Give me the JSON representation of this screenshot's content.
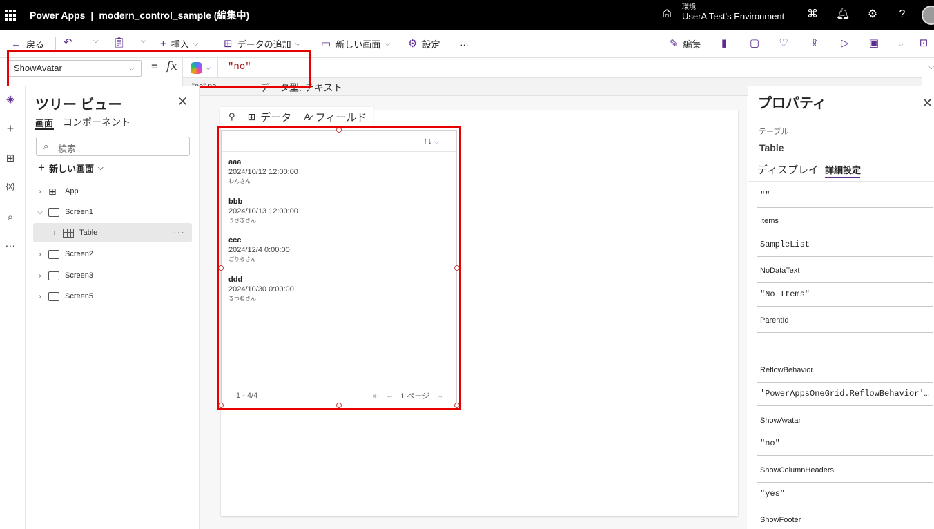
{
  "header": {
    "app_name": "Power Apps",
    "separator": "|",
    "doc_title": "modern_control_sample (編集中)",
    "env_label": "環境",
    "env_name": "UserA Test's Environment"
  },
  "toolbar": {
    "back": "戻る",
    "insert": "挿入",
    "add_data": "データの追加",
    "new_screen": "新しい画面",
    "settings": "設定",
    "more": "…",
    "edit": "編集"
  },
  "formula_bar": {
    "property": "ShowAvatar",
    "equals": "=",
    "fx": "fx",
    "value": "\"no\""
  },
  "suggestion": {
    "code": "\"no\"    no",
    "type_label": "データ型: テキスト"
  },
  "tree_view": {
    "title": "ツリー ビュー",
    "tabs": [
      "画面",
      "コンポーネント"
    ],
    "search_placeholder": "検索",
    "new_screen": "新しい画面",
    "items": [
      {
        "label": "App"
      },
      {
        "label": "Screen1"
      },
      {
        "label": "Table"
      },
      {
        "label": "Screen2"
      },
      {
        "label": "Screen3"
      },
      {
        "label": "Screen5"
      }
    ]
  },
  "context_toolbar": {
    "data": "データ",
    "fields": "フィールド"
  },
  "table": {
    "sort_icon": "↑↓",
    "rows": [
      {
        "title": "aaa",
        "date": "2024/10/12 12:00:00",
        "sub": "わんさん"
      },
      {
        "title": "bbb",
        "date": "2024/10/13 12:00:00",
        "sub": "うさぎさん"
      },
      {
        "title": "ccc",
        "date": "2024/12/4 0:00:00",
        "sub": "ごりらさん"
      },
      {
        "title": "ddd",
        "date": "2024/10/30 0:00:00",
        "sub": "きつねさん"
      }
    ],
    "pager_count": "1 - 4/4",
    "pager_page": "1 ページ"
  },
  "properties": {
    "title": "プロパティ",
    "control_kind": "テーブル",
    "control_name": "Table",
    "tabs": [
      "ディスプレイ",
      "詳細設定"
    ],
    "fields": [
      {
        "label": "",
        "value": "\"\""
      },
      {
        "label": "Items",
        "value": "SampleList"
      },
      {
        "label": "NoDataText",
        "value": "\"No Items\""
      },
      {
        "label": "ParentId",
        "value": ""
      },
      {
        "label": "ReflowBehavior",
        "value": "'PowerAppsOneGrid.ReflowBehavior'.Lis…"
      },
      {
        "label": "ShowAvatar",
        "value": "\"no\""
      },
      {
        "label": "ShowColumnHeaders",
        "value": "\"yes\""
      },
      {
        "label": "ShowFooter",
        "value": ""
      }
    ]
  },
  "colors": {
    "accent": "#5c2d91",
    "highlight": "#e60000",
    "topbar": "#000000"
  }
}
